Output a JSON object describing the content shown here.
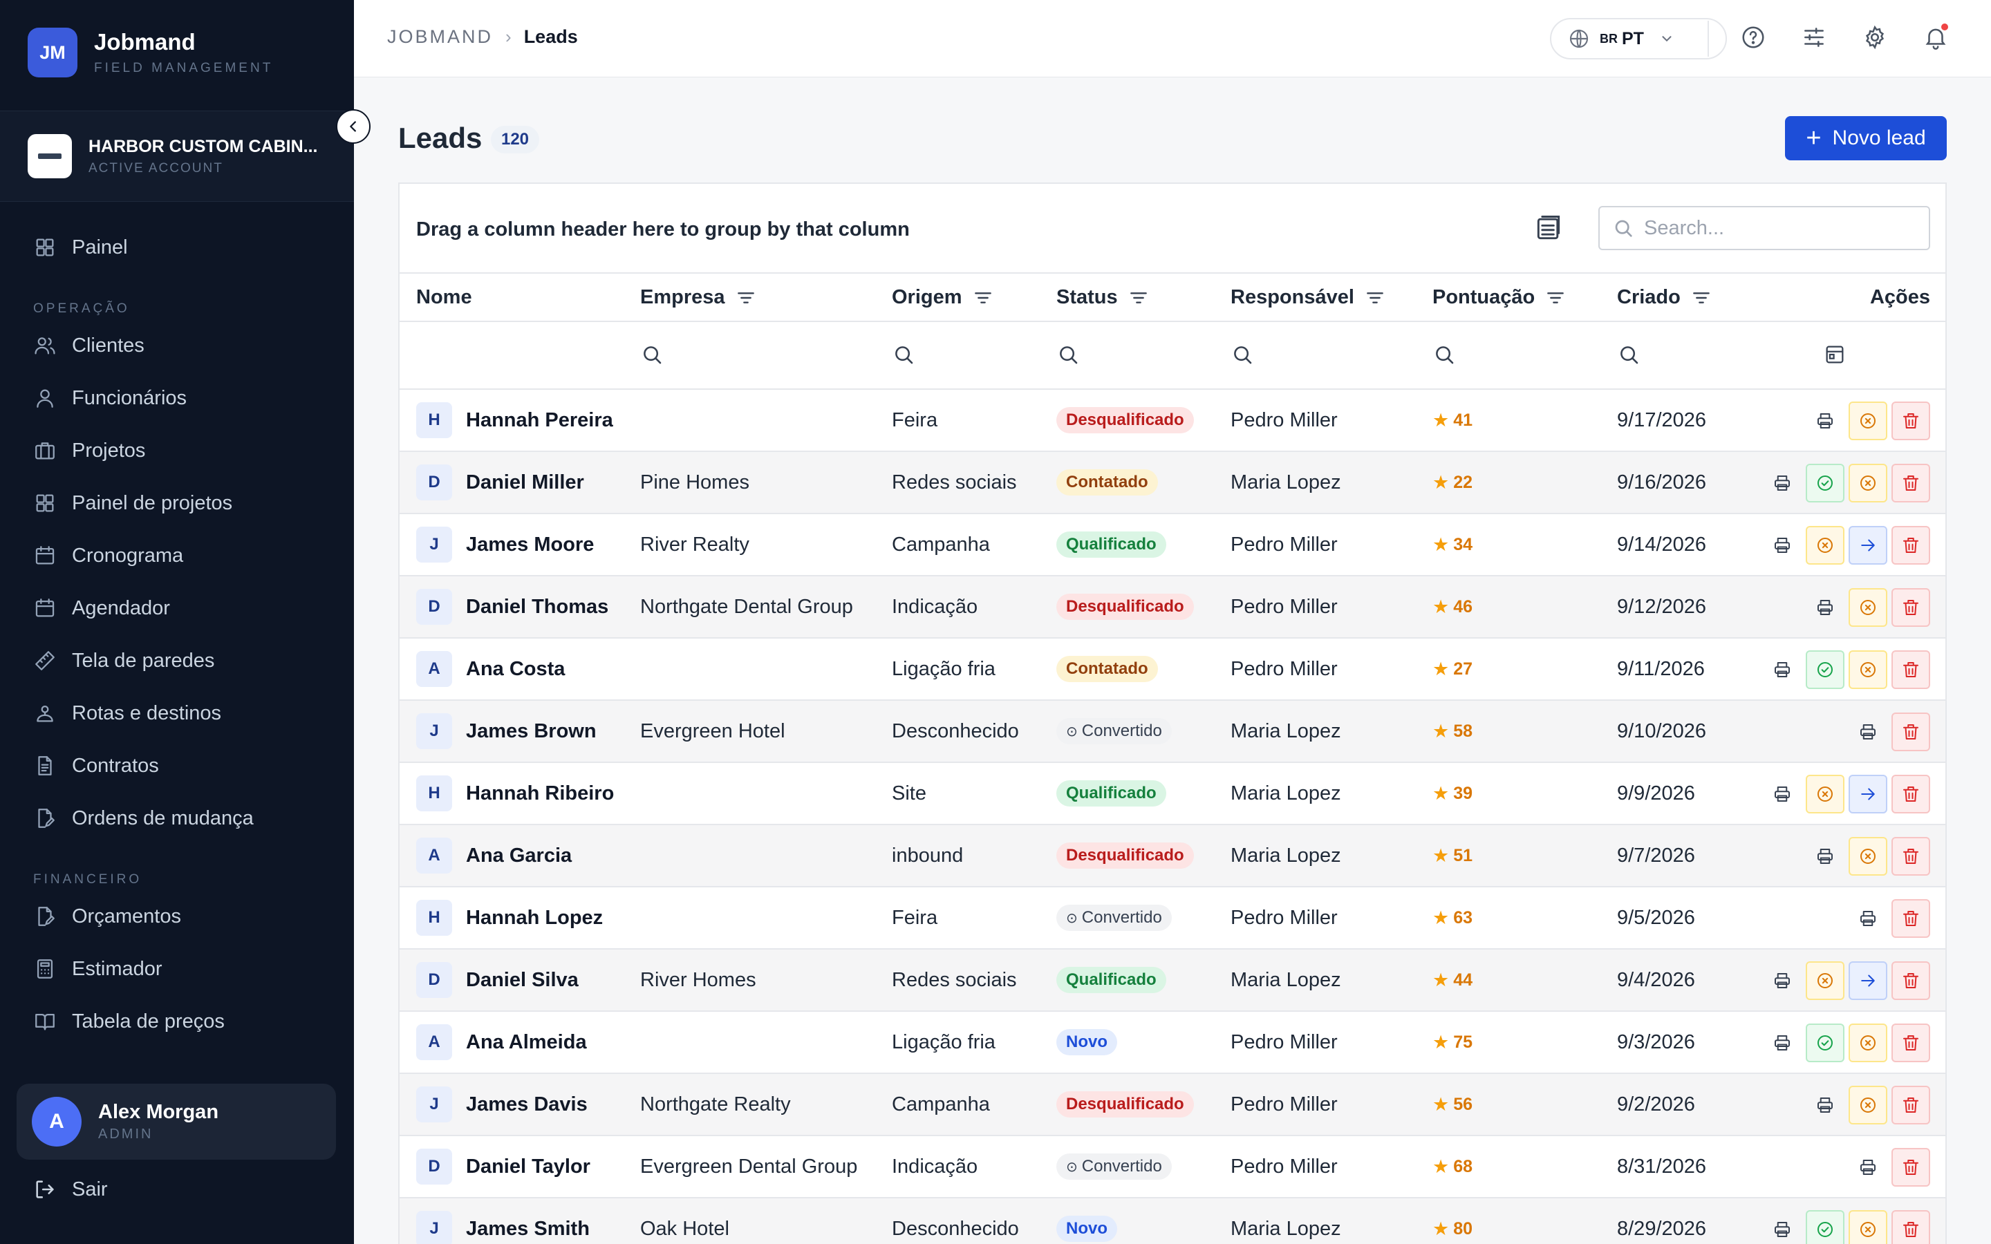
{
  "app": {
    "logo_initials": "JM",
    "name": "Jobmand",
    "subtitle": "FIELD MANAGEMENT"
  },
  "account": {
    "name": "HARBOR CUSTOM CABIN...",
    "status": "ACTIVE ACCOUNT"
  },
  "sidebar": {
    "items": [
      {
        "label": "Painel",
        "icon": "dashboard-grid-icon"
      },
      {
        "section": "OPERAÇÃO"
      },
      {
        "label": "Clientes",
        "icon": "users-icon"
      },
      {
        "label": "Funcionários",
        "icon": "user-icon"
      },
      {
        "label": "Projetos",
        "icon": "briefcase-icon"
      },
      {
        "label": "Painel de projetos",
        "icon": "grid-icon"
      },
      {
        "label": "Cronograma",
        "icon": "calendar-icon"
      },
      {
        "label": "Agendador",
        "icon": "calendar-icon"
      },
      {
        "label": "Tela de paredes",
        "icon": "ruler-icon"
      },
      {
        "label": "Rotas e destinos",
        "icon": "map-pin-icon"
      },
      {
        "label": "Contratos",
        "icon": "document-icon"
      },
      {
        "label": "Ordens de mudança",
        "icon": "document-edit-icon"
      },
      {
        "section": "FINANCEIRO"
      },
      {
        "label": "Orçamentos",
        "icon": "document-edit-icon"
      },
      {
        "label": "Estimador",
        "icon": "calculator-icon"
      },
      {
        "label": "Tabela de preços",
        "icon": "book-icon"
      }
    ]
  },
  "user": {
    "initial": "A",
    "name": "Alex Morgan",
    "role": "ADMIN"
  },
  "logout_label": "Sair",
  "header": {
    "breadcrumb_root": "JOBMAND",
    "breadcrumb_current": "Leads",
    "language_flag": "BR",
    "language_code": "PT"
  },
  "page": {
    "title": "Leads",
    "count": "120",
    "new_button": "Novo lead"
  },
  "grid": {
    "group_hint": "Drag a column header here to group by that column",
    "search_placeholder": "Search...",
    "columns": [
      "Nome",
      "Empresa",
      "Origem",
      "Status",
      "Responsável",
      "Pontuação",
      "Criado",
      "Ações"
    ],
    "rows": [
      {
        "initial": "H",
        "name": "Hannah Pereira",
        "company": "",
        "origin": "Feira",
        "status": "Desqualificado",
        "owner": "Pedro Miller",
        "score": "41",
        "created": "9/17/2026",
        "actions": [
          "print",
          "reject",
          "delete"
        ]
      },
      {
        "initial": "D",
        "name": "Daniel Miller",
        "company": "Pine Homes",
        "origin": "Redes sociais",
        "status": "Contatado",
        "owner": "Maria Lopez",
        "score": "22",
        "created": "9/16/2026",
        "actions": [
          "print",
          "qualify",
          "reject",
          "delete"
        ]
      },
      {
        "initial": "J",
        "name": "James Moore",
        "company": "River Realty",
        "origin": "Campanha",
        "status": "Qualificado",
        "owner": "Pedro Miller",
        "score": "34",
        "created": "9/14/2026",
        "actions": [
          "print",
          "reject",
          "convert",
          "delete"
        ]
      },
      {
        "initial": "D",
        "name": "Daniel Thomas",
        "company": "Northgate Dental Group",
        "origin": "Indicação",
        "status": "Desqualificado",
        "owner": "Pedro Miller",
        "score": "46",
        "created": "9/12/2026",
        "actions": [
          "print",
          "reject",
          "delete"
        ]
      },
      {
        "initial": "A",
        "name": "Ana Costa",
        "company": "",
        "origin": "Ligação fria",
        "status": "Contatado",
        "owner": "Pedro Miller",
        "score": "27",
        "created": "9/11/2026",
        "actions": [
          "print",
          "qualify",
          "reject",
          "delete"
        ]
      },
      {
        "initial": "J",
        "name": "James Brown",
        "company": "Evergreen Hotel",
        "origin": "Desconhecido",
        "status": "Convertido",
        "owner": "Maria Lopez",
        "score": "58",
        "created": "9/10/2026",
        "actions": [
          "print",
          "delete"
        ]
      },
      {
        "initial": "H",
        "name": "Hannah Ribeiro",
        "company": "",
        "origin": "Site",
        "status": "Qualificado",
        "owner": "Maria Lopez",
        "score": "39",
        "created": "9/9/2026",
        "actions": [
          "print",
          "reject",
          "convert",
          "delete"
        ]
      },
      {
        "initial": "A",
        "name": "Ana Garcia",
        "company": "",
        "origin": "inbound",
        "status": "Desqualificado",
        "owner": "Maria Lopez",
        "score": "51",
        "created": "9/7/2026",
        "actions": [
          "print",
          "reject",
          "delete"
        ]
      },
      {
        "initial": "H",
        "name": "Hannah Lopez",
        "company": "",
        "origin": "Feira",
        "status": "Convertido",
        "owner": "Pedro Miller",
        "score": "63",
        "created": "9/5/2026",
        "actions": [
          "print",
          "delete"
        ]
      },
      {
        "initial": "D",
        "name": "Daniel Silva",
        "company": "River Homes",
        "origin": "Redes sociais",
        "status": "Qualificado",
        "owner": "Maria Lopez",
        "score": "44",
        "created": "9/4/2026",
        "actions": [
          "print",
          "reject",
          "convert",
          "delete"
        ]
      },
      {
        "initial": "A",
        "name": "Ana Almeida",
        "company": "",
        "origin": "Ligação fria",
        "status": "Novo",
        "owner": "Pedro Miller",
        "score": "75",
        "created": "9/3/2026",
        "actions": [
          "print",
          "qualify",
          "reject",
          "delete"
        ]
      },
      {
        "initial": "J",
        "name": "James Davis",
        "company": "Northgate Realty",
        "origin": "Campanha",
        "status": "Desqualificado",
        "owner": "Pedro Miller",
        "score": "56",
        "created": "9/2/2026",
        "actions": [
          "print",
          "reject",
          "delete"
        ]
      },
      {
        "initial": "D",
        "name": "Daniel Taylor",
        "company": "Evergreen Dental Group",
        "origin": "Indicação",
        "status": "Convertido",
        "owner": "Pedro Miller",
        "score": "68",
        "created": "8/31/2026",
        "actions": [
          "print",
          "delete"
        ]
      },
      {
        "initial": "J",
        "name": "James Smith",
        "company": "Oak Hotel",
        "origin": "Desconhecido",
        "status": "Novo",
        "owner": "Maria Lopez",
        "score": "80",
        "created": "8/29/2026",
        "actions": [
          "print",
          "qualify",
          "reject",
          "delete"
        ]
      }
    ]
  },
  "colors": {
    "sidebar_bg": "#0d1525",
    "primary": "#1d4ed8",
    "status_desqualificado": "#b91c1c",
    "status_contatado": "#92400e",
    "status_qualificado": "#15803d",
    "status_novo": "#1d4ed8",
    "score": "#d97706"
  }
}
